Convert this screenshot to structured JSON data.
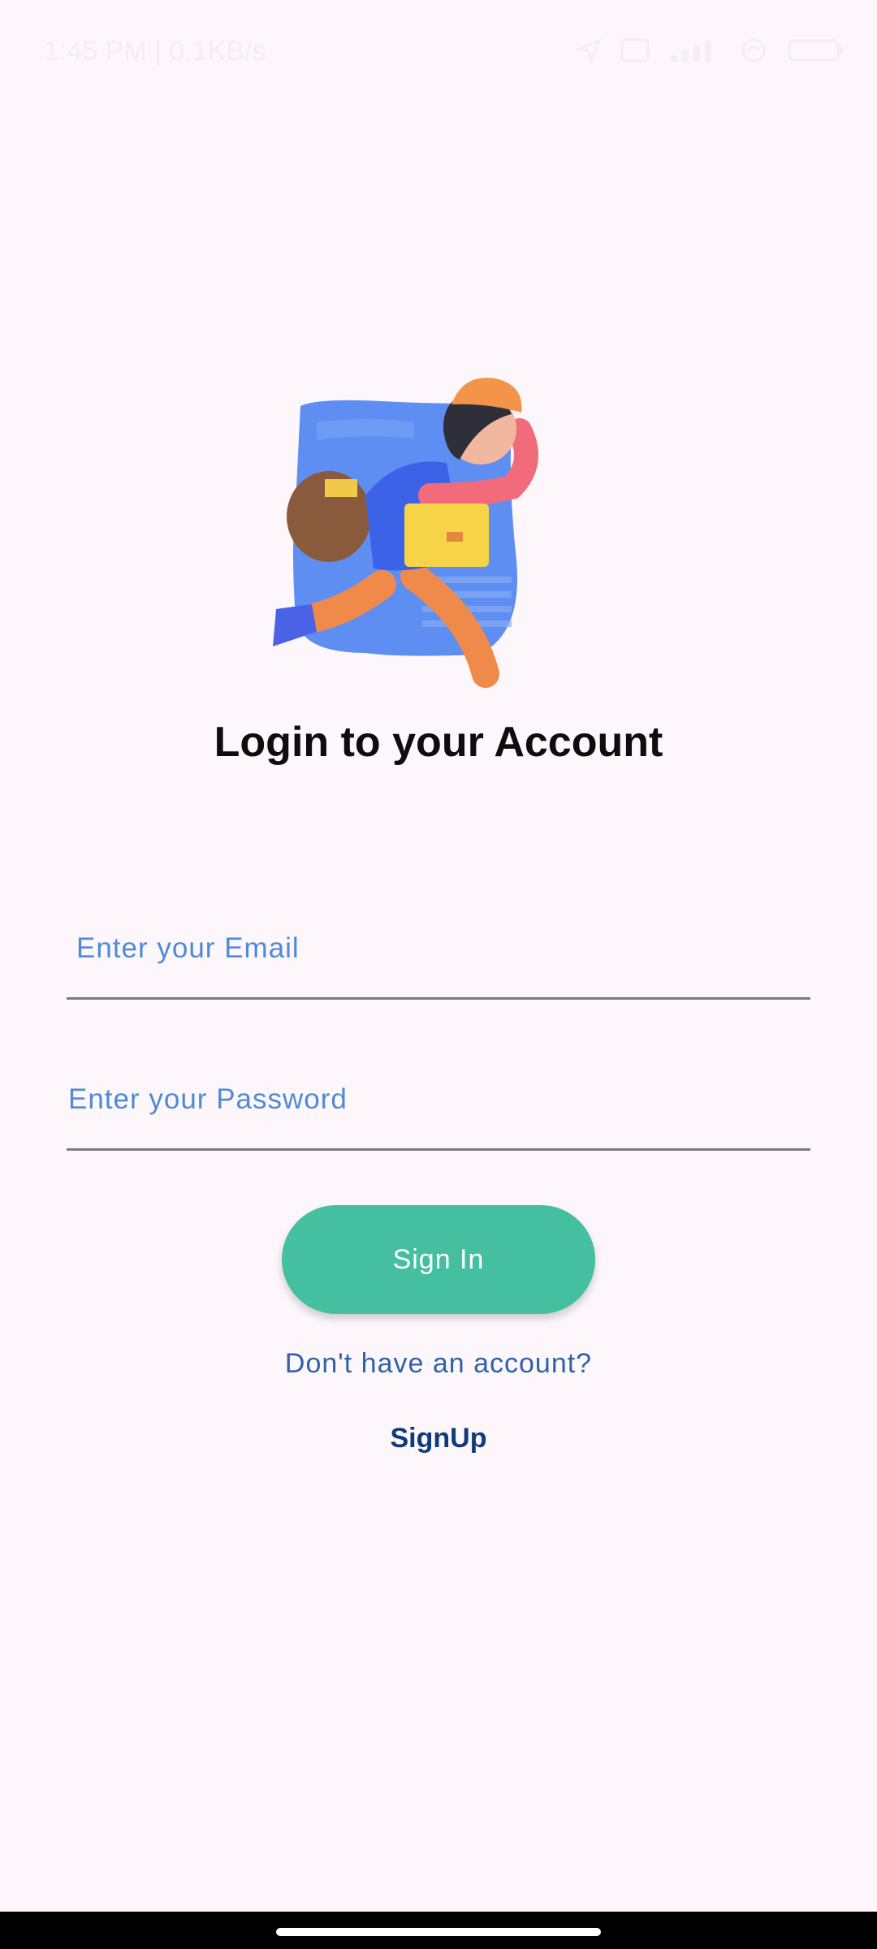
{
  "status_bar": {
    "time_text": "1:45 PM | 0.1KB/s",
    "icons": [
      "location-icon",
      "sim-icon",
      "signal-icon",
      "wifi-icon",
      "battery-icon"
    ]
  },
  "illustration": {
    "icon": "delivery-person-illustration"
  },
  "login": {
    "title": "Login to your Account",
    "email_label": "Enter your Email",
    "password_label": "Enter your Password",
    "signin_label": "Sign In",
    "account_prompt": "Don't have an account?",
    "signup_label": "SignUp"
  },
  "colors": {
    "background": "#fdf7fc",
    "accent": "#44bfa0",
    "label_blue": "#4e8ad8",
    "link_blue": "#0e3b7a"
  }
}
